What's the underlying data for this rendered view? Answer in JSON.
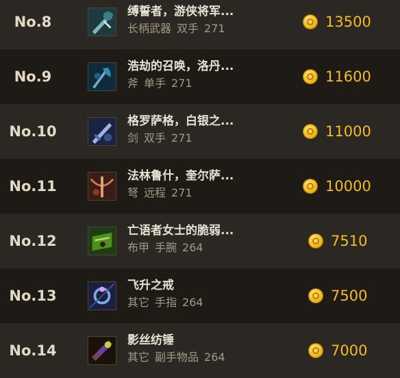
{
  "rows": [
    {
      "rank": "No.8",
      "name": "缚誓者，游侠将军...",
      "meta": [
        "长柄武器",
        "双手",
        "271"
      ],
      "price": "13500",
      "icon": "polearm-icon"
    },
    {
      "rank": "No.9",
      "name": "浩劫的召唤，洛丹...",
      "meta": [
        "斧",
        "单手",
        "271"
      ],
      "price": "11600",
      "icon": "axe-icon"
    },
    {
      "rank": "No.10",
      "name": "格罗萨格，白银之...",
      "meta": [
        "剑",
        "双手",
        "271"
      ],
      "price": "11000",
      "icon": "sword-icon"
    },
    {
      "rank": "No.11",
      "name": "法林鲁什，奎尔萨...",
      "meta": [
        "弩",
        "远程",
        "271"
      ],
      "price": "10000",
      "icon": "crossbow-icon"
    },
    {
      "rank": "No.12",
      "name": "亡语者女士的脆弱...",
      "meta": [
        "布甲",
        "手腕",
        "264"
      ],
      "price": "7510",
      "icon": "bracer-icon"
    },
    {
      "rank": "No.13",
      "name": "飞升之戒",
      "meta": [
        "其它",
        "手指",
        "264"
      ],
      "price": "7500",
      "icon": "ring-icon"
    },
    {
      "rank": "No.14",
      "name": "影丝纺锤",
      "meta": [
        "其它",
        "副手物品",
        "264"
      ],
      "price": "7000",
      "icon": "spindle-icon"
    }
  ]
}
